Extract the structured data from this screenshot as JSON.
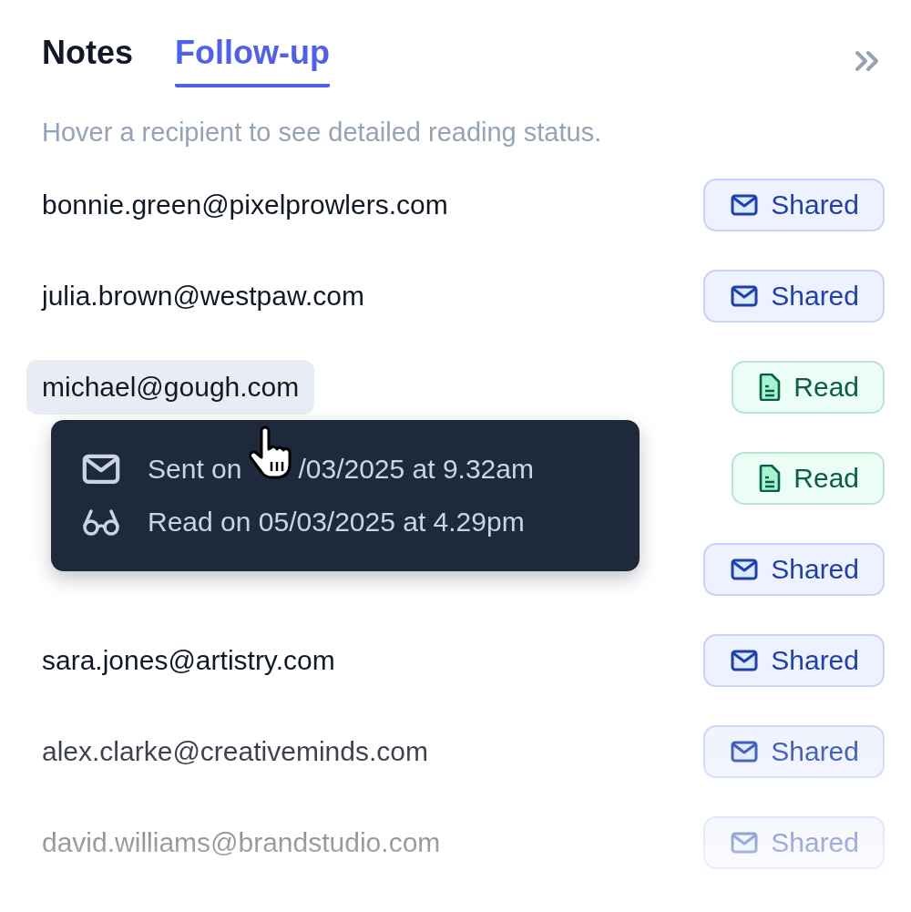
{
  "tabs": [
    {
      "label": "Notes",
      "selected": false
    },
    {
      "label": "Follow-up",
      "selected": true
    }
  ],
  "hint": "Hover a recipient to see detailed reading status.",
  "recipients": [
    {
      "email": "bonnie.green@pixelprowlers.com",
      "status": {
        "kind": "shared",
        "label": "Shared"
      }
    },
    {
      "email": "julia.brown@westpaw.com",
      "status": {
        "kind": "shared",
        "label": "Shared"
      }
    },
    {
      "email": "michael@gough.com",
      "status": {
        "kind": "read",
        "label": "Read"
      },
      "tooltip": {
        "lines": [
          {
            "kind": "sent",
            "parts": [
              "Sent on",
              "/03/2025 at 9.32am"
            ]
          },
          {
            "kind": "read",
            "parts": [
              "Read on 05/03/2025 at 4.29pm"
            ]
          }
        ]
      }
    },
    {
      "status": {
        "kind": "read",
        "label": "Read"
      }
    },
    {
      "status": {
        "kind": "shared",
        "label": "Shared"
      }
    },
    {
      "email": "sara.jones@artistry.com",
      "status": {
        "kind": "shared",
        "label": "Shared"
      }
    },
    {
      "email": "alex.clarke@creativeminds.com",
      "status": {
        "kind": "shared",
        "label": "Shared"
      }
    },
    {
      "email": "david.williams@brandstudio.com",
      "status": {
        "kind": "shared",
        "label": "Shared"
      }
    }
  ]
}
